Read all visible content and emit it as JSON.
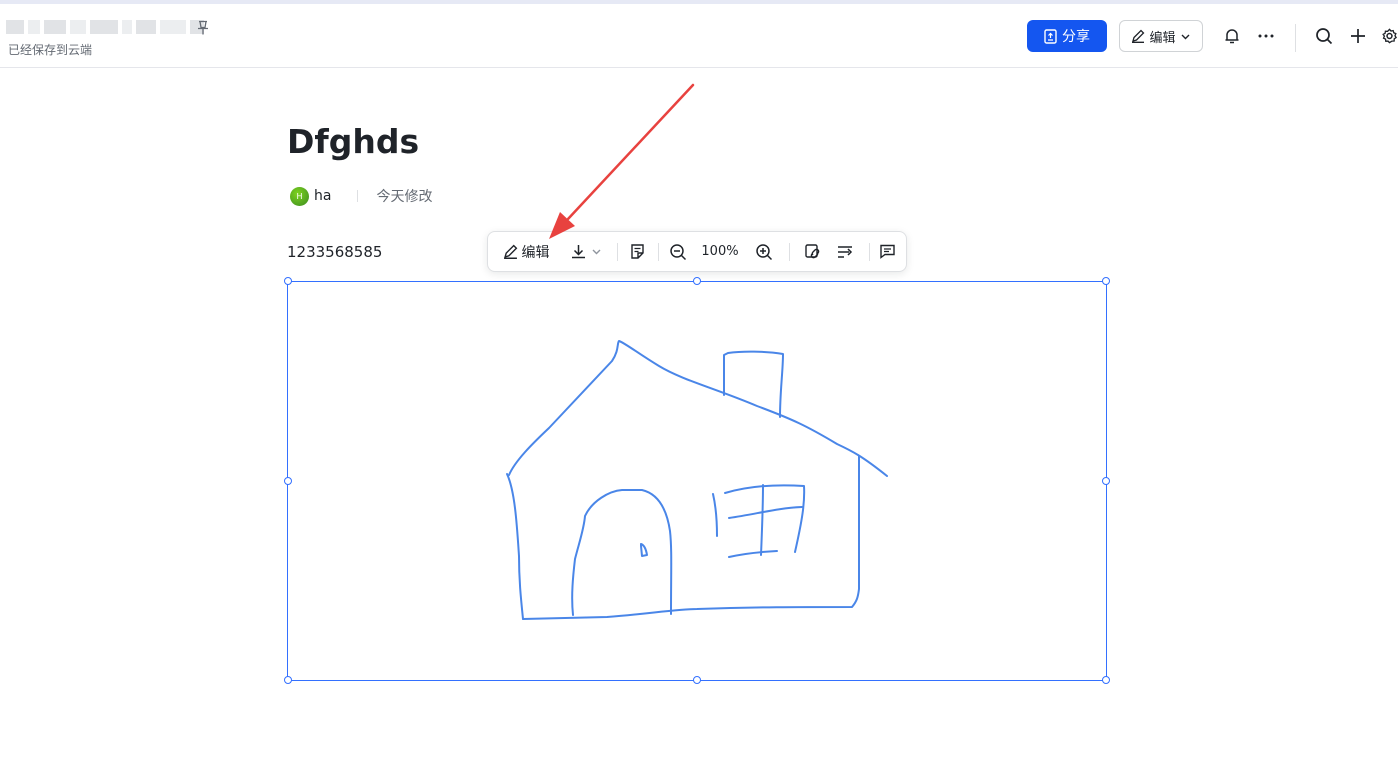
{
  "header": {
    "saved_status": "已经保存到云端",
    "share_label": "分享",
    "edit_label": "编辑"
  },
  "document": {
    "title": "Dfghds",
    "author": "ha",
    "avatar_letter": "H",
    "modified": "今天修改",
    "body_text": "1233568585"
  },
  "image_toolbar": {
    "edit_label": "编辑",
    "zoom": "100%"
  },
  "colors": {
    "accent": "#1456f0",
    "selection": "#3370ff",
    "sketch_stroke": "#4a86e8",
    "annotation_arrow": "#e8423f"
  },
  "icons": [
    "pin-icon",
    "share-doc-icon",
    "pencil-icon",
    "chevron-down-icon",
    "bell-icon",
    "more-icon",
    "search-icon",
    "plus-icon",
    "gear-icon",
    "download-icon",
    "ocr-icon",
    "zoom-out-icon",
    "zoom-in-icon",
    "link-icon",
    "wrap-icon",
    "comment-icon"
  ]
}
